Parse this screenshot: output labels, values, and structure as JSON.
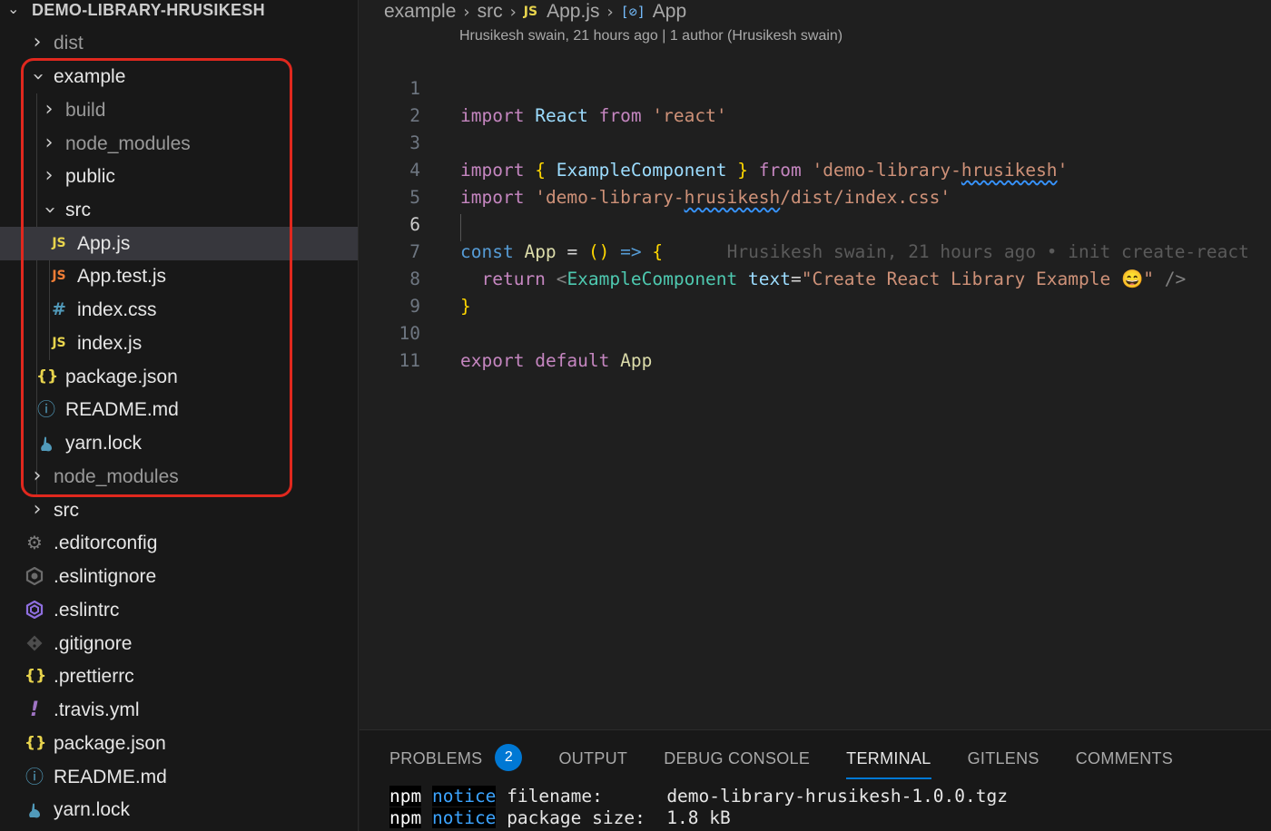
{
  "explorer": {
    "root_label": "DEMO-LIBRARY-HRUSIKESH",
    "items": [
      {
        "label": "dist"
      },
      {
        "label": "example"
      },
      {
        "label": "build"
      },
      {
        "label": "node_modules"
      },
      {
        "label": "public"
      },
      {
        "label": "src"
      },
      {
        "label": "App.js",
        "icon_text": "JS"
      },
      {
        "label": "App.test.js",
        "icon_text": "JS"
      },
      {
        "label": "index.css",
        "icon_text": "#"
      },
      {
        "label": "index.js",
        "icon_text": "JS"
      },
      {
        "label": "package.json",
        "icon_text": "{}"
      },
      {
        "label": "README.md",
        "icon_text": "ⓘ"
      },
      {
        "label": "yarn.lock"
      },
      {
        "label": "node_modules"
      },
      {
        "label": "src"
      },
      {
        "label": ".editorconfig"
      },
      {
        "label": ".eslintignore"
      },
      {
        "label": ".eslintrc"
      },
      {
        "label": ".gitignore"
      },
      {
        "label": ".prettierrc",
        "icon_text": "{}"
      },
      {
        "label": ".travis.yml",
        "icon_text": "!"
      },
      {
        "label": "package.json",
        "icon_text": "{}"
      },
      {
        "label": "README.md",
        "icon_text": "ⓘ"
      },
      {
        "label": "yarn.lock"
      }
    ]
  },
  "breadcrumb": {
    "segments": [
      "example",
      "src",
      "App.js",
      "App"
    ],
    "js_badge": "JS",
    "symbol_icon": "[⊘]"
  },
  "blame_header": "Hrusikesh swain, 21 hours ago | 1 author (Hrusikesh swain)",
  "code": {
    "line_numbers": [
      "1",
      "2",
      "3",
      "4",
      "5",
      "6",
      "7",
      "8",
      "9",
      "10",
      "11"
    ],
    "l1": {
      "import": "import",
      "react": "React",
      "from": "from",
      "str": "'react'"
    },
    "l3": {
      "import": "import",
      "ob": "{",
      "name": "ExampleComponent",
      "cb": "}",
      "from": "from",
      "str_pre": "'",
      "str_sq": "demo-library-",
      "str_wavy": "hrusikesh",
      "str_post": "'"
    },
    "l4": {
      "import": "import",
      "str_a": "'demo-library-",
      "str_wavy": "hrusikesh",
      "str_b": "/dist/index.css'"
    },
    "l6": {
      "const": "const",
      "app": "App",
      "eq": "=",
      "paren": "()",
      "arrow": "=>",
      "ob": "{",
      "blame": "Hrusikesh swain, 21 hours ago • init create-react"
    },
    "l7": {
      "ret": "return",
      "lt": "<",
      "comp": "ExampleComponent",
      "attr": "text",
      "eq": "=",
      "str": "\"Create React Library Example 😄\"",
      "end": "/>"
    },
    "l8": {
      "cb": "}"
    },
    "l10": {
      "export": "export",
      "default": "default",
      "app": "App"
    }
  },
  "panel": {
    "tabs": [
      "PROBLEMS",
      "OUTPUT",
      "DEBUG CONSOLE",
      "TERMINAL",
      "GITLENS",
      "COMMENTS"
    ],
    "problems_count": "2",
    "active_tab": "TERMINAL",
    "terminal_lines": [
      {
        "npm": "npm",
        "notice": "notice",
        "key": "filename:",
        "value": "demo-library-hrusikesh-1.0.0.tgz"
      },
      {
        "npm": "npm",
        "notice": "notice",
        "key": "package size:",
        "value": "1.8 kB"
      }
    ]
  },
  "colors": {
    "highlight_box": "#e0281e",
    "accent": "#0078d4",
    "js_icon": "#e8d44d",
    "json_icon": "#e8d44d",
    "css_icon": "#519aba",
    "info_icon": "#519aba"
  }
}
